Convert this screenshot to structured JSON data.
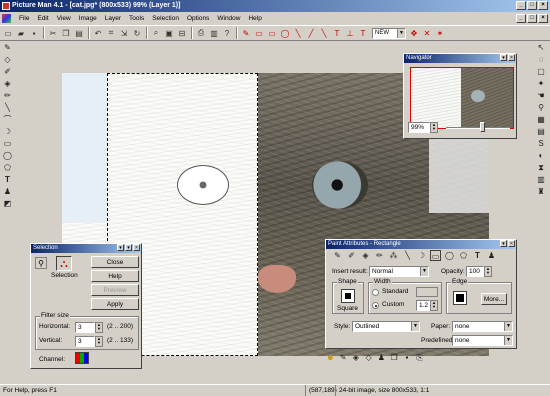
{
  "window": {
    "title": "Picture Man 4.1 - [cat.jpg* (800x533) 99% (Layer 1)]",
    "buttons": [
      "_",
      "□",
      "×"
    ]
  },
  "menu": {
    "items": [
      "File",
      "Edit",
      "View",
      "Image",
      "Layer",
      "Tools",
      "Selection",
      "Options",
      "Window",
      "Help"
    ]
  },
  "toolbar": {
    "mode_value": "NEW"
  },
  "selection_panel": {
    "title": "Selection",
    "tool_label": "Selection",
    "close_label": "Close",
    "help_label": "Help",
    "preview_label": "Preview",
    "apply_label": "Apply",
    "filter_size_label": "Filter size",
    "horizontal_label": "Horizontal:",
    "horizontal_value": "3",
    "horizontal_range": "(2 .. 200)",
    "vertical_label": "Vertical:",
    "vertical_value": "3",
    "vertical_range": "(2 .. 133)",
    "channel_label": "Channel:"
  },
  "navigator": {
    "title": "Navigator",
    "zoom_value": "99%"
  },
  "paint_panel": {
    "title": "Paint Attributes - Rectangle",
    "insert_result_label": "Insert result:",
    "insert_result_value": "Normal",
    "opacity_label": "Opacity:",
    "opacity_value": "100",
    "shape_group": "Shape",
    "shape_label": "Square",
    "width_group": "Width",
    "standard_label": "Standard",
    "custom_label": "Custom",
    "custom_value": "1.2",
    "edge_group": "Edge",
    "more_label": "More...",
    "style_label": "Style:",
    "style_value": "Outlined",
    "paper_label": "Paper:",
    "paper_value": "none",
    "predefined_label": "Predefined:",
    "predefined_value": "none"
  },
  "status": {
    "help": "For Help, press F1",
    "coords": "(587,189)",
    "info": "24-bit image, size 800x533, 1:1"
  },
  "colors": {
    "title_gradient_start": "#0a246a",
    "title_gradient_end": "#a6caf0",
    "chrome": "#d4d0c8"
  }
}
